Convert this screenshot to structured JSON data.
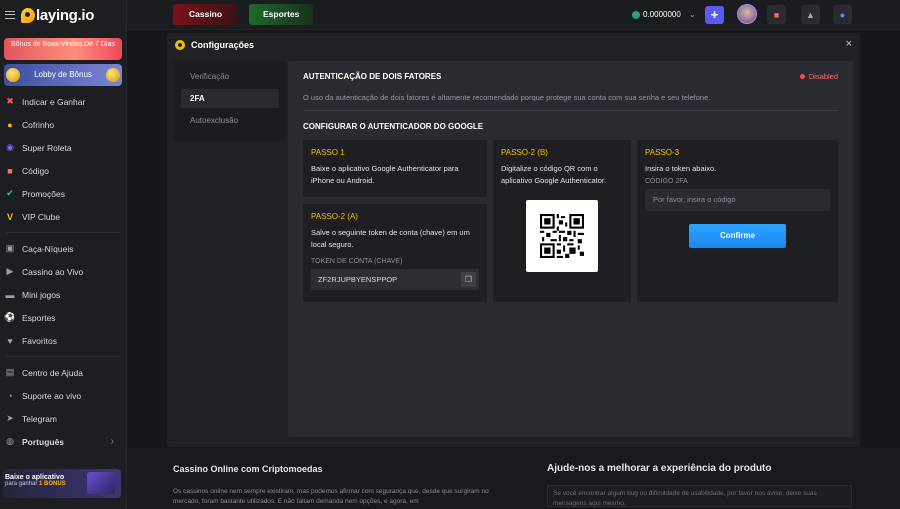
{
  "brand": {
    "logo_text": "laying.io"
  },
  "sidebar": {
    "promo_welcome": "Bônus de Boas-Vindas De 7 Dias",
    "promo_lobby": "Lobby de Bônus",
    "items": [
      {
        "label": "Indicar e Ganhar",
        "icon": "share-icon"
      },
      {
        "label": "Cofrinho",
        "icon": "piggy-icon"
      },
      {
        "label": "Super Roleta",
        "icon": "wheel-icon"
      },
      {
        "label": "Código",
        "icon": "gift-code-icon"
      },
      {
        "label": "Promoções",
        "icon": "promo-icon"
      },
      {
        "label": "VIP Clube",
        "icon": "vip-icon"
      },
      {
        "label": "Caça-Níqueis",
        "icon": "slot-icon"
      },
      {
        "label": "Cassino ao Vivo",
        "icon": "live-icon"
      },
      {
        "label": "Mini jogos",
        "icon": "gamepad-icon"
      },
      {
        "label": "Esportes",
        "icon": "sports-icon"
      },
      {
        "label": "Favoritos",
        "icon": "heart-icon"
      },
      {
        "label": "Centro de Ajuda",
        "icon": "help-icon"
      },
      {
        "label": "Suporte ao vivo",
        "icon": "support-icon"
      },
      {
        "label": "Telegram",
        "icon": "telegram-icon"
      },
      {
        "label": "Português",
        "icon": "globe-icon"
      }
    ],
    "app_banner": {
      "title": "Baixe o aplicativo",
      "subtitle_prefix": "para ganhar",
      "subtitle_bonus": "1 BONUS"
    }
  },
  "topbar": {
    "tab_cassino": "Cassino",
    "tab_esportes": "Esportes",
    "balance": "0.0000000",
    "plus": "+"
  },
  "modal": {
    "title": "Configurações",
    "close": "×",
    "menu": [
      "Verificação",
      "2FA",
      "Autoexclusão"
    ],
    "heading": "AUTENTICAÇÃO DE DOIS FATORES",
    "status": "Disabled",
    "description": "O uso da autenticação de dois fatores é altamente recomendado porque protege sua conta com sua senha e seu telefone.",
    "section_title": "CONFIGURAR O AUTENTICADOR DO GOOGLE",
    "step1": {
      "label": "PASSO 1",
      "text": "Baixe o aplicativo Google Authenticator para iPhone ou Android."
    },
    "step2a": {
      "label": "PASSO-2 (A)",
      "text": "Salve o seguinte token de conta (chave) em um local seguro.",
      "token_label": "TOKEN DE CONTA (CHAVE)",
      "token": "ZF2RJUPBYENSPPOP"
    },
    "step2b": {
      "label": "PASSO-2 (B)",
      "text": "Digitalize o código QR com o aplicativo Google Authenticator."
    },
    "step3": {
      "label": "PASSO-3",
      "text": "Insira o token abaixo.",
      "code_label": "CÓDIGO 2FA",
      "placeholder": "Por favor, insira o código",
      "confirm": "Confirme"
    }
  },
  "footer": {
    "title_left": "Cassino Online com Criptomoedas",
    "text_left": "Os cassinos online nem sempre existiram, mas podemos afirmar com segurança que, desde que surgiram no mercado, foram bastante utilizados. E não faltam demanda nem opções, e agora, em",
    "title_right": "Ajude-nos a melhorar a experiência do produto",
    "text_right": "Se você encontrar algum bug ou dificuldade de usabilidade, por favor nos avise, deixe suas mensagens aqui mesmo."
  },
  "colors": {
    "accent": "#f5c000",
    "confirm": "#2aa4ff",
    "disabled": "#ff4a4a",
    "plus": "#5a5cf0"
  }
}
